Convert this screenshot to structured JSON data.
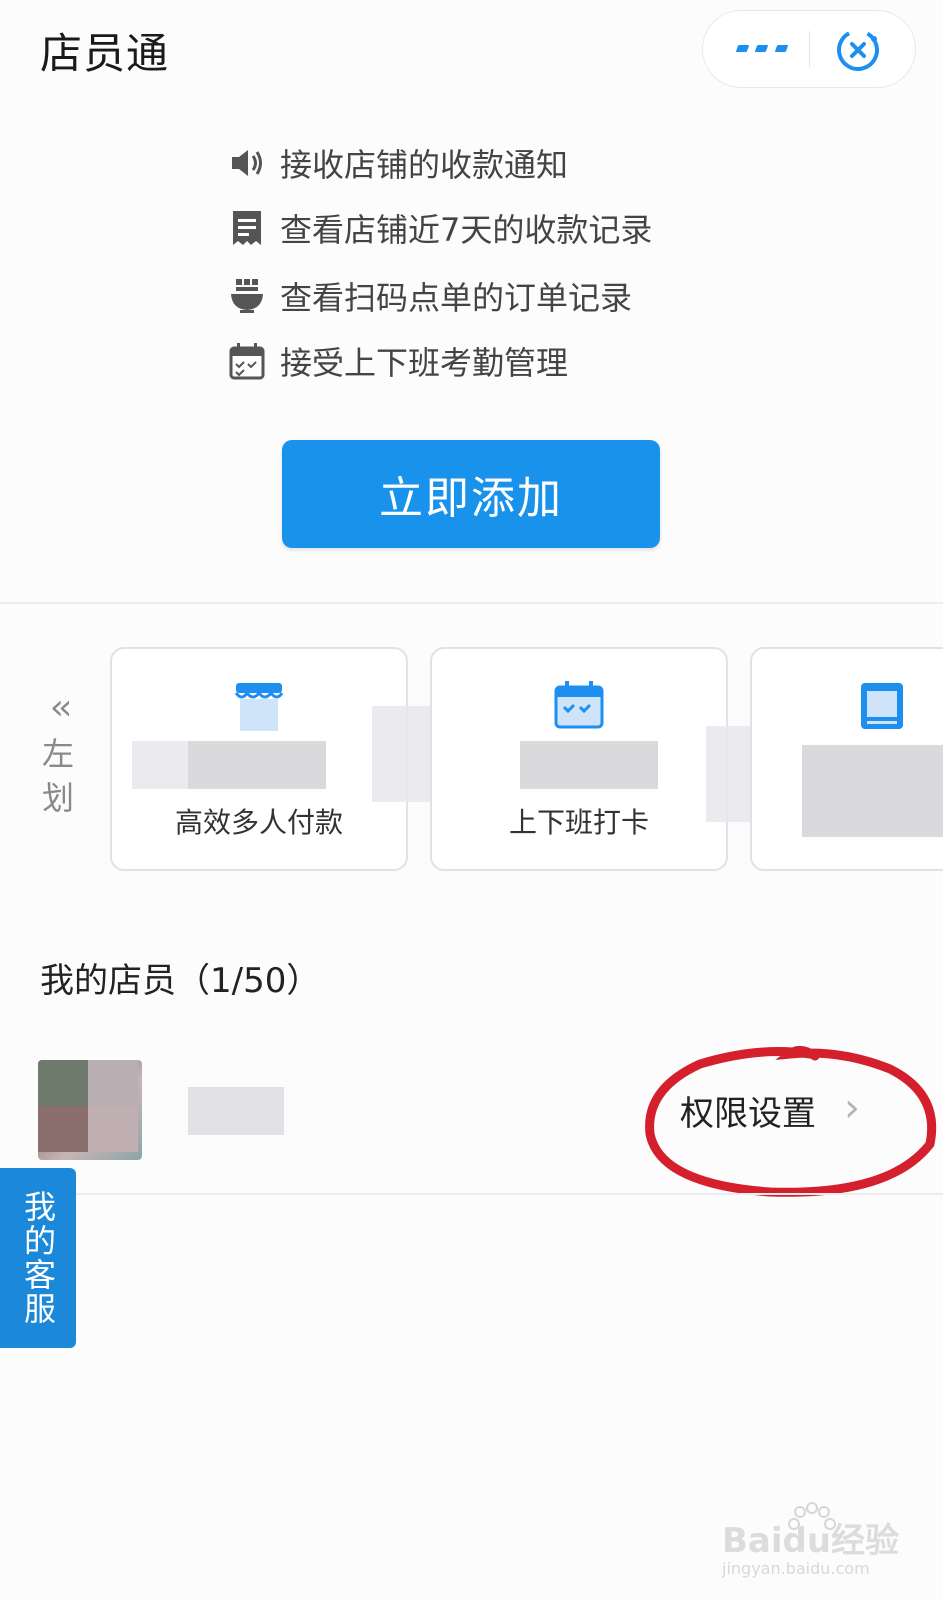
{
  "header": {
    "title": "店员通",
    "more_icon": "more-dots-icon",
    "close_icon": "close-mini-program-icon",
    "accent": "#1d8ff0"
  },
  "features": [
    {
      "icon": "speaker-icon",
      "text": "接收店铺的收款通知"
    },
    {
      "icon": "receipt-icon",
      "text": "查看店铺近7天的收款记录"
    },
    {
      "icon": "food-bowl-icon",
      "text": "查看扫码点单的订单记录"
    },
    {
      "icon": "calendar-check-icon",
      "text": "接受上下班考勤管理"
    }
  ],
  "add_button": {
    "label": "立即添加",
    "color": "#1992ec"
  },
  "carousel": {
    "hint_top": "左",
    "hint_bottom": "划",
    "cards": [
      {
        "icon": "shop-icon",
        "label": "高效多人付款"
      },
      {
        "icon": "calendar-icon",
        "label": "上下班打卡"
      },
      {
        "icon": "tablet-icon",
        "label": ""
      }
    ]
  },
  "staff": {
    "heading": "我的店员（1/50）",
    "rows": [
      {
        "name": "",
        "action": "权限设置"
      }
    ]
  },
  "service_tab": {
    "label": "我的客服",
    "color": "#1b88d9"
  },
  "watermark": {
    "brand": "Baidu经验",
    "url": "jingyan.baidu.com"
  },
  "annotation_color": "#d4202c"
}
